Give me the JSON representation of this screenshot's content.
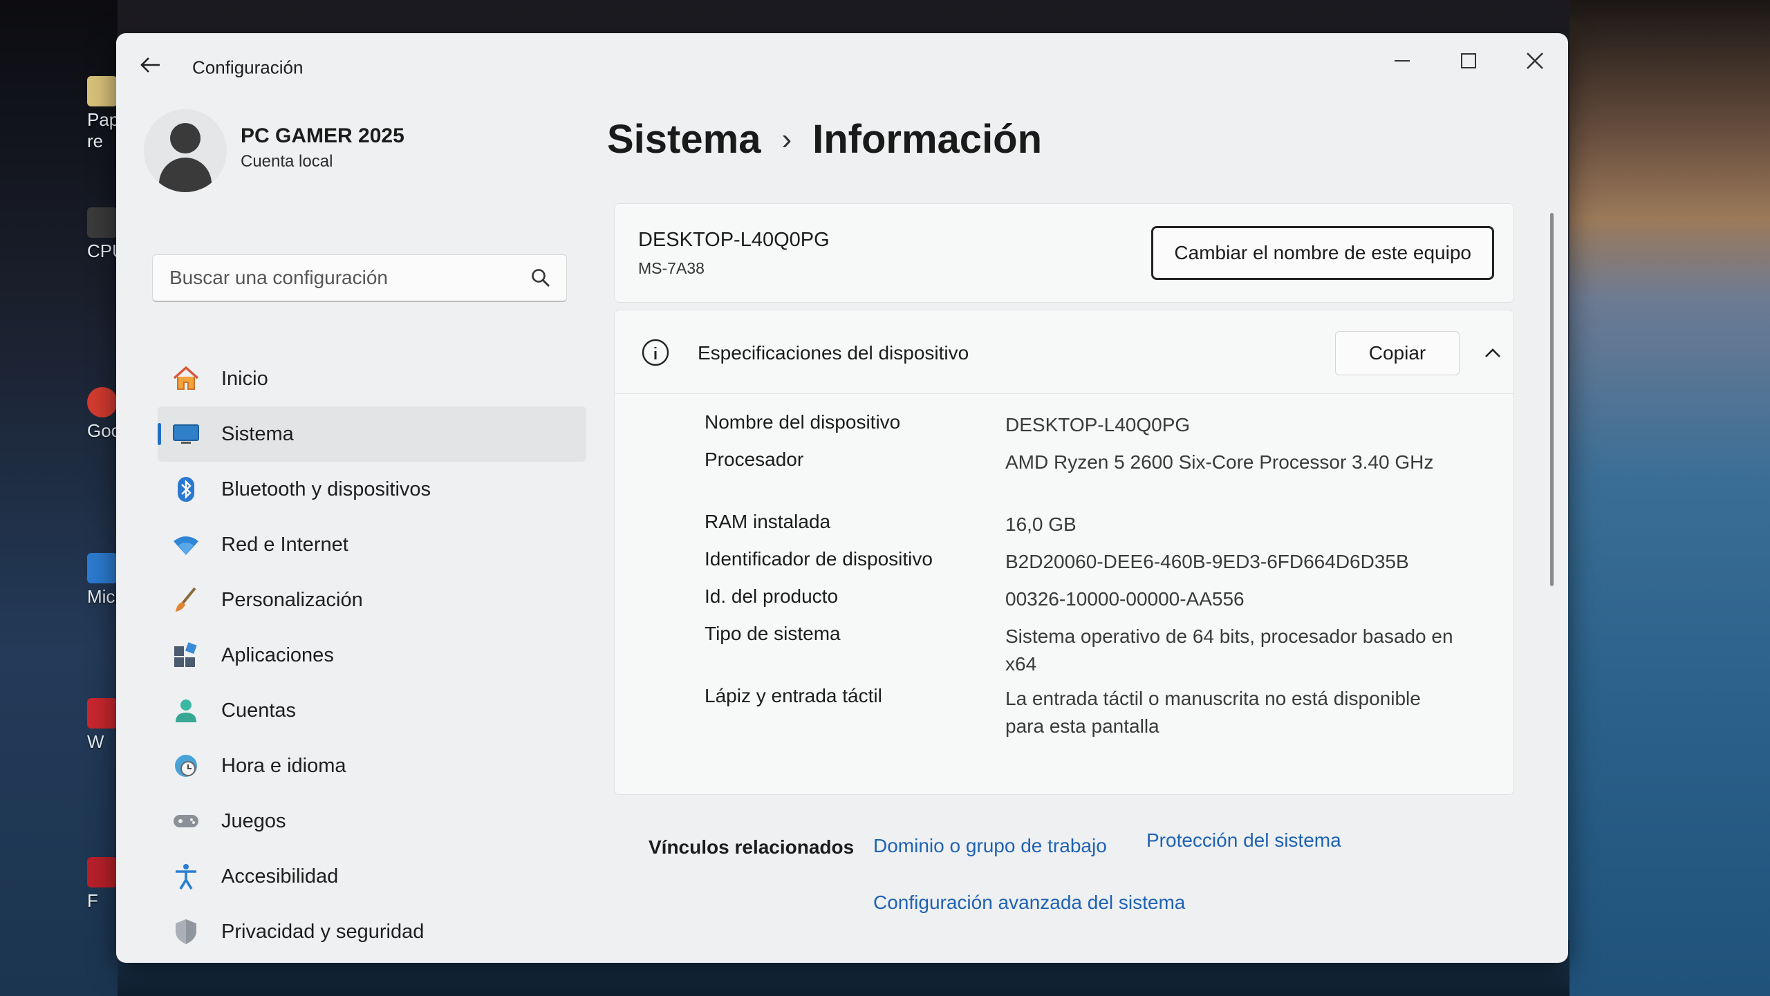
{
  "desktop": {
    "icons": [
      {
        "label": "Pap re"
      },
      {
        "label": "CPU"
      },
      {
        "label": "Goog"
      },
      {
        "label": "Micr"
      },
      {
        "label": "W"
      },
      {
        "label": "F"
      }
    ]
  },
  "window": {
    "title": "Configuración",
    "back_icon": "arrow-left-icon",
    "controls": [
      "minimize",
      "maximize",
      "close"
    ]
  },
  "profile": {
    "name": "PC GAMER 2025",
    "account_type": "Cuenta local"
  },
  "search": {
    "placeholder": "Buscar una configuración"
  },
  "sidebar": {
    "items": [
      {
        "label": "Inicio",
        "icon": "home-icon",
        "active": false
      },
      {
        "label": "Sistema",
        "icon": "monitor-icon",
        "active": true
      },
      {
        "label": "Bluetooth y dispositivos",
        "icon": "bluetooth-icon",
        "active": false
      },
      {
        "label": "Red e Internet",
        "icon": "wifi-icon",
        "active": false
      },
      {
        "label": "Personalización",
        "icon": "brush-icon",
        "active": false
      },
      {
        "label": "Aplicaciones",
        "icon": "apps-icon",
        "active": false
      },
      {
        "label": "Cuentas",
        "icon": "user-icon",
        "active": false
      },
      {
        "label": "Hora e idioma",
        "icon": "clock-globe-icon",
        "active": false
      },
      {
        "label": "Juegos",
        "icon": "gamepad-icon",
        "active": false
      },
      {
        "label": "Accesibilidad",
        "icon": "accessibility-icon",
        "active": false
      },
      {
        "label": "Privacidad y seguridad",
        "icon": "shield-icon",
        "active": false
      }
    ]
  },
  "breadcrumb": {
    "parent": "Sistema",
    "separator": "›",
    "current": "Información"
  },
  "device": {
    "name": "DESKTOP-L40Q0PG",
    "model": "MS-7A38",
    "rename_label": "Cambiar el nombre de este equipo"
  },
  "specs": {
    "title": "Especificaciones del dispositivo",
    "copy_label": "Copiar",
    "rows": [
      {
        "label": "Nombre del dispositivo",
        "value": "DESKTOP-L40Q0PG"
      },
      {
        "label": "Procesador",
        "value": "AMD Ryzen 5 2600 Six-Core Processor 3.40 GHz"
      },
      {
        "label": "RAM instalada",
        "value": "16,0 GB"
      },
      {
        "label": "Identificador de dispositivo",
        "value": "B2D20060-DEE6-460B-9ED3-6FD664D6D35B"
      },
      {
        "label": "Id. del producto",
        "value": "00326-10000-00000-AA556"
      },
      {
        "label": "Tipo de sistema",
        "value": "Sistema operativo de 64 bits, procesador basado en x64"
      },
      {
        "label": "Lápiz y entrada táctil",
        "value": "La entrada táctil o manuscrita no está disponible para esta pantalla"
      }
    ]
  },
  "related": {
    "label": "Vínculos relacionados",
    "links": [
      "Dominio o grupo de trabajo",
      "Protección del sistema",
      "Configuración avanzada del sistema"
    ]
  },
  "colors": {
    "accent": "#1f6fc5",
    "link": "#1f62b5",
    "window_bg": "#eef0f1"
  }
}
